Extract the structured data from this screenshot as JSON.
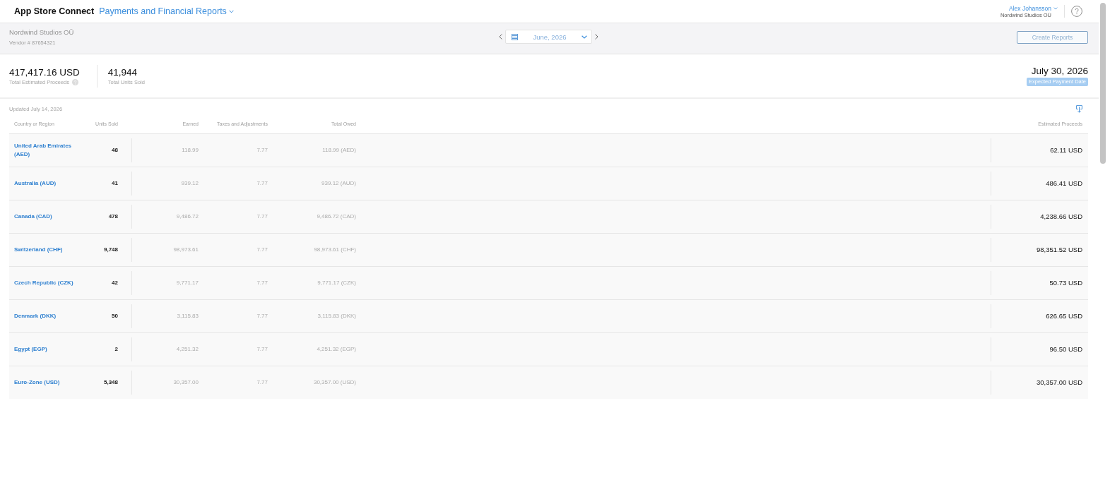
{
  "header": {
    "app_title": "App Store Connect",
    "section_menu": "Payments and Financial Reports",
    "user_name": "Alex Johansson",
    "user_org": "Nordwind Studios OÜ"
  },
  "account_bar": {
    "company": "Nordwind Studios OÜ",
    "vendor": "Vendor # 87654321",
    "period": "June, 2026",
    "create_button": "Create Reports"
  },
  "summary": {
    "metrics": [
      {
        "value": "417,417.16 USD",
        "label": "Total Estimated Proceeds",
        "info": true
      },
      {
        "value": "41,944",
        "label": "Total Units Sold",
        "info": false
      }
    ],
    "payment_date": "July 30, 2026",
    "payment_badge": "Expected Payment Date"
  },
  "table": {
    "updated": "Updated July 14, 2026",
    "columns": [
      "Country or Region",
      "Units Sold",
      "Earned",
      "Taxes and Adjustments",
      "Total Owed",
      "Estimated Proceeds"
    ],
    "rows": [
      {
        "country": "United Arab Emirates (AED)",
        "units": "48",
        "earned": "118.99",
        "taxes": "7.77",
        "total_owed": "118.99 (AED)",
        "estimated_proceeds": "62.11 USD"
      },
      {
        "country": "Australia (AUD)",
        "units": "41",
        "earned": "939.12",
        "taxes": "7.77",
        "total_owed": "939.12 (AUD)",
        "estimated_proceeds": "486.41 USD"
      },
      {
        "country": "Canada (CAD)",
        "units": "478",
        "earned": "9,486.72",
        "taxes": "7.77",
        "total_owed": "9,486.72 (CAD)",
        "estimated_proceeds": "4,238.66 USD"
      },
      {
        "country": "Switzerland (CHF)",
        "units": "9,748",
        "earned": "98,973.61",
        "taxes": "7.77",
        "total_owed": "98,973.61 (CHF)",
        "estimated_proceeds": "98,351.52 USD"
      },
      {
        "country": "Czech Republic (CZK)",
        "units": "42",
        "earned": "9,771.17",
        "taxes": "7.77",
        "total_owed": "9,771.17 (CZK)",
        "estimated_proceeds": "50.73 USD"
      },
      {
        "country": "Denmark (DKK)",
        "units": "50",
        "earned": "3,115.83",
        "taxes": "7.77",
        "total_owed": "3,115.83 (DKK)",
        "estimated_proceeds": "626.65 USD"
      },
      {
        "country": "Egypt (EGP)",
        "units": "2",
        "earned": "4,251.32",
        "taxes": "7.77",
        "total_owed": "4,251.32 (EGP)",
        "estimated_proceeds": "96.50 USD"
      },
      {
        "country": "Euro-Zone (USD)",
        "units": "5,348",
        "earned": "30,357.00",
        "taxes": "7.77",
        "total_owed": "30,357.00 (USD)",
        "estimated_proceeds": "30,357.00 USD"
      }
    ]
  }
}
